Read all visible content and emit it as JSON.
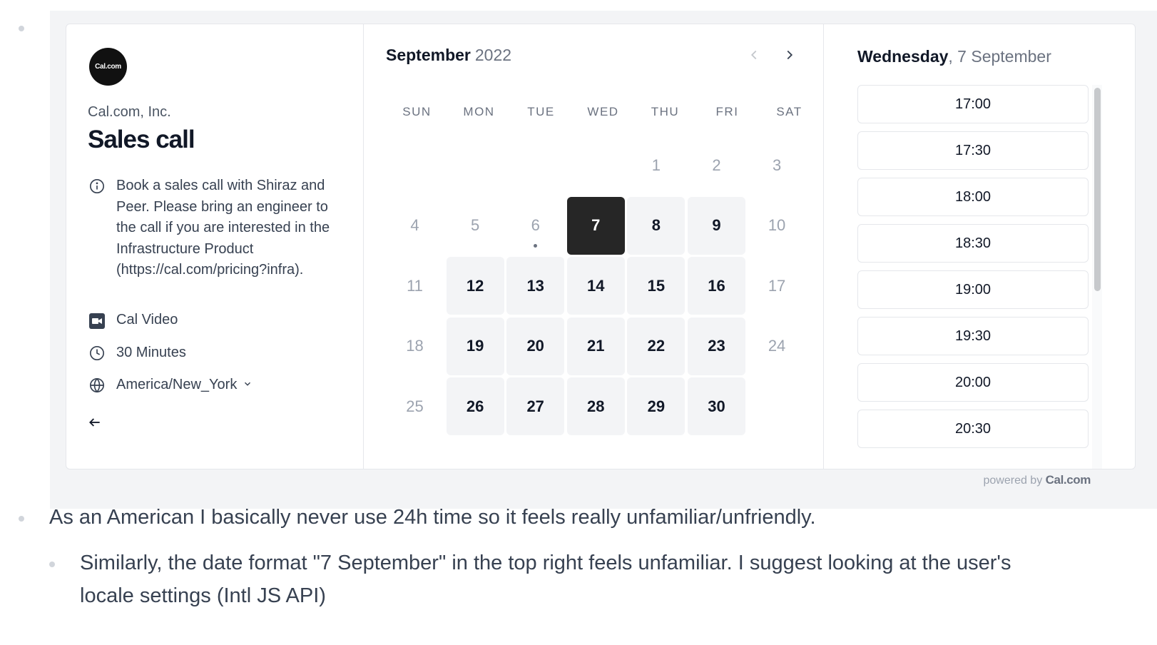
{
  "booking": {
    "logo_text": "Cal.com",
    "org_name": "Cal.com, Inc.",
    "event_title": "Sales call",
    "description": "Book a sales call with Shiraz and Peer. Please bring an engineer to the call if you are interested in the Infrastructure Product (https://cal.com/pricing?infra).",
    "location": "Cal Video",
    "duration": "30 Minutes",
    "timezone": "America/New_York"
  },
  "calendar": {
    "month": "September",
    "year": "2022",
    "weekdays": [
      "SUN",
      "MON",
      "TUE",
      "WED",
      "THU",
      "FRI",
      "SAT"
    ],
    "days": [
      {
        "label": "",
        "state": "empty"
      },
      {
        "label": "",
        "state": "empty"
      },
      {
        "label": "",
        "state": "empty"
      },
      {
        "label": "",
        "state": "empty"
      },
      {
        "label": "1",
        "state": "disabled"
      },
      {
        "label": "2",
        "state": "disabled"
      },
      {
        "label": "3",
        "state": "disabled"
      },
      {
        "label": "4",
        "state": "disabled"
      },
      {
        "label": "5",
        "state": "disabled"
      },
      {
        "label": "6",
        "state": "disabled",
        "today": true
      },
      {
        "label": "7",
        "state": "selected"
      },
      {
        "label": "8",
        "state": "avail"
      },
      {
        "label": "9",
        "state": "avail"
      },
      {
        "label": "10",
        "state": "disabled"
      },
      {
        "label": "11",
        "state": "disabled"
      },
      {
        "label": "12",
        "state": "avail"
      },
      {
        "label": "13",
        "state": "avail"
      },
      {
        "label": "14",
        "state": "avail"
      },
      {
        "label": "15",
        "state": "avail"
      },
      {
        "label": "16",
        "state": "avail"
      },
      {
        "label": "17",
        "state": "disabled"
      },
      {
        "label": "18",
        "state": "disabled"
      },
      {
        "label": "19",
        "state": "avail"
      },
      {
        "label": "20",
        "state": "avail"
      },
      {
        "label": "21",
        "state": "avail"
      },
      {
        "label": "22",
        "state": "avail"
      },
      {
        "label": "23",
        "state": "avail"
      },
      {
        "label": "24",
        "state": "disabled"
      },
      {
        "label": "25",
        "state": "disabled"
      },
      {
        "label": "26",
        "state": "avail"
      },
      {
        "label": "27",
        "state": "avail"
      },
      {
        "label": "28",
        "state": "avail"
      },
      {
        "label": "29",
        "state": "avail"
      },
      {
        "label": "30",
        "state": "avail"
      }
    ]
  },
  "selected_date": {
    "weekday": "Wednesday",
    "rest": ", 7 September"
  },
  "time_slots": [
    "17:00",
    "17:30",
    "18:00",
    "18:30",
    "19:00",
    "19:30",
    "20:00",
    "20:30"
  ],
  "footer": {
    "powered_by": "powered by",
    "brand": "Cal.com"
  },
  "comments": {
    "main": "As an American I basically never use 24h time so it feels really unfamiliar/unfriendly.",
    "sub_line1": "Similarly, the date format \"7 September\" in the top right feels unfamiliar. I suggest looking at the user's",
    "sub_line2": "locale settings (Intl JS API)"
  }
}
